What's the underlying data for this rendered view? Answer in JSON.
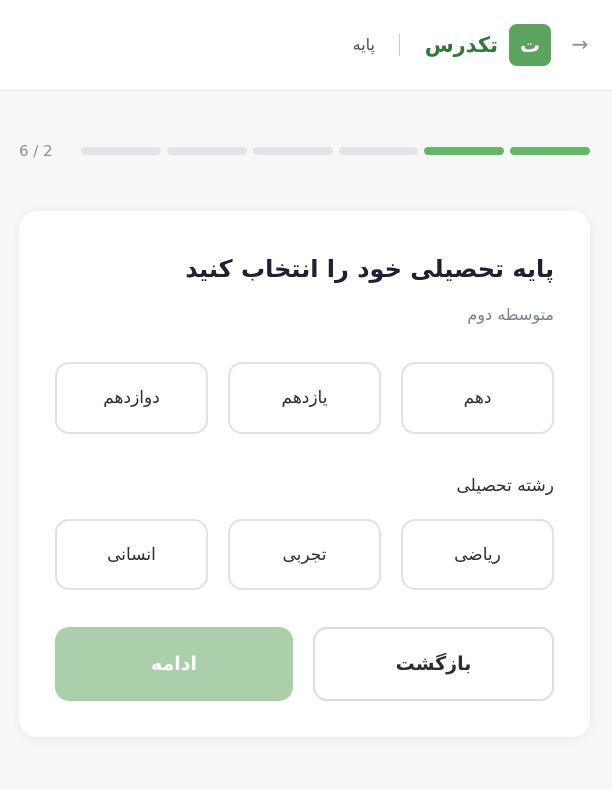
{
  "header": {
    "back_arrow": "→",
    "logo_letter": "ت",
    "brand_name": "تکدرس",
    "breadcrumb": "پایه"
  },
  "progress": {
    "current": 2,
    "total": 6,
    "counter_text": "6 / 2"
  },
  "card": {
    "title": "پایه تحصیلی خود را انتخاب کنید",
    "subtitle": "متوسطه دوم",
    "grades": [
      "دهم",
      "یازدهم",
      "دوازدهم"
    ],
    "field_label": "رشته تحصیلی",
    "fields": [
      "ریاضی",
      "تجربی",
      "انسانی"
    ],
    "back_label": "بازگشت",
    "continue_label": "ادامه"
  },
  "colors": {
    "brand": "#5ba35f",
    "progress_done": "#63b765",
    "progress_todo": "#e3e4e7",
    "continue_disabled": "#abcfa9"
  },
  "icons": {
    "back": "arrow-right-icon",
    "logo": "logo-badge-icon"
  }
}
